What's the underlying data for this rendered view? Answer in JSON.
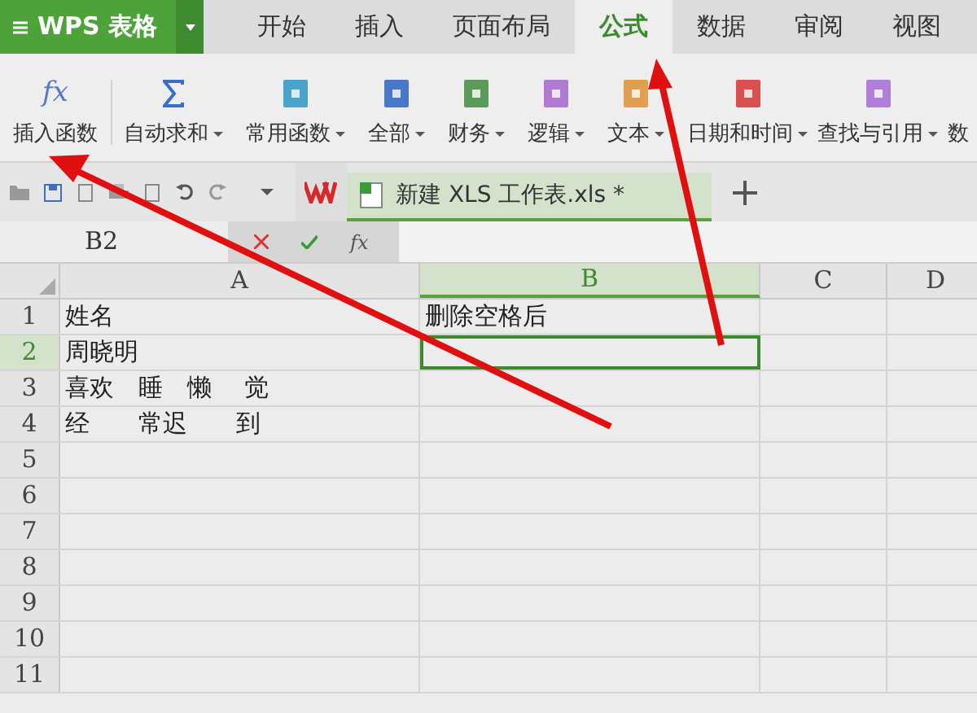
{
  "app_menu": {
    "label": "WPS 表格"
  },
  "tabs": [
    {
      "label": "开始",
      "selected": false
    },
    {
      "label": "插入",
      "selected": false
    },
    {
      "label": "页面布局",
      "selected": false
    },
    {
      "label": "公式",
      "selected": true
    },
    {
      "label": "数据",
      "selected": false
    },
    {
      "label": "审阅",
      "selected": false
    },
    {
      "label": "视图",
      "selected": false
    }
  ],
  "ribbon": [
    {
      "kind": "fx",
      "icon_text": "fx",
      "label": "插入函数",
      "dropdown": false
    },
    {
      "kind": "sigma",
      "label": "自动求和",
      "dropdown": true
    },
    {
      "kind": "book",
      "color": "#4aa3c8",
      "label": "常用函数",
      "dropdown": true
    },
    {
      "kind": "book",
      "color": "#4a78c8",
      "label": "全部",
      "dropdown": true
    },
    {
      "kind": "book",
      "color": "#5a9a5a",
      "label": "财务",
      "dropdown": true
    },
    {
      "kind": "book",
      "color": "#b07ad0",
      "label": "逻辑",
      "dropdown": true
    },
    {
      "kind": "book",
      "color": "#e0a050",
      "label": "文本",
      "dropdown": true
    },
    {
      "kind": "book",
      "color": "#d85050",
      "label": "日期和时间",
      "dropdown": true
    },
    {
      "kind": "book",
      "color": "#b080d8",
      "label": "查找与引用",
      "dropdown": true
    },
    {
      "kind": "cut",
      "label": "数",
      "dropdown": false
    }
  ],
  "document_tab": {
    "label": "新建 XLS 工作表.xls *"
  },
  "name_box": {
    "value": "B2"
  },
  "formula_bar": {
    "function_label": "fx"
  },
  "columns": [
    {
      "label": "A",
      "selected": false
    },
    {
      "label": "B",
      "selected": true
    },
    {
      "label": "C",
      "selected": false
    },
    {
      "label": "D",
      "selected": false
    }
  ],
  "rows": [
    {
      "number": "1",
      "selected": false,
      "cells": [
        "姓名",
        "删除空格后"
      ]
    },
    {
      "number": "2",
      "selected": true,
      "cells": [
        "周晓明",
        ""
      ]
    },
    {
      "number": "3",
      "selected": false,
      "cells": [
        "喜欢　睡　懒　 觉"
      ]
    },
    {
      "number": "4",
      "selected": false,
      "cells": [
        "经　　常迟　　到"
      ]
    },
    {
      "number": "5",
      "selected": false,
      "cells": []
    },
    {
      "number": "6",
      "selected": false,
      "cells": []
    },
    {
      "number": "7",
      "selected": false,
      "cells": []
    },
    {
      "number": "8",
      "selected": false,
      "cells": []
    },
    {
      "number": "9",
      "selected": false,
      "cells": []
    },
    {
      "number": "10",
      "selected": false,
      "cells": []
    },
    {
      "number": "11",
      "selected": false,
      "cells": []
    }
  ]
}
